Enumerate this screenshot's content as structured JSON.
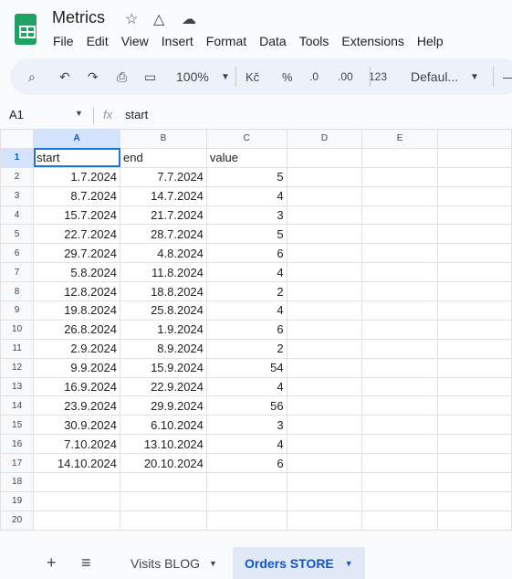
{
  "app": {
    "title": "Metrics",
    "menu": [
      "File",
      "Edit",
      "View",
      "Insert",
      "Format",
      "Data",
      "Tools",
      "Extensions",
      "Help"
    ]
  },
  "toolbar": {
    "zoom": "100%",
    "currency": "Kč",
    "percent": "%",
    "dec_decrease": ".0",
    "dec_increase": ".00",
    "number_format": "123",
    "font": "Defaul..."
  },
  "formula_bar": {
    "cell_ref": "A1",
    "fx": "fx",
    "value": "start"
  },
  "sheet": {
    "columns": [
      "A",
      "B",
      "C",
      "D",
      "E"
    ],
    "rows": [
      [
        "start",
        "end",
        "value"
      ],
      [
        "1.7.2024",
        "7.7.2024",
        "5"
      ],
      [
        "8.7.2024",
        "14.7.2024",
        "4"
      ],
      [
        "15.7.2024",
        "21.7.2024",
        "3"
      ],
      [
        "22.7.2024",
        "28.7.2024",
        "5"
      ],
      [
        "29.7.2024",
        "4.8.2024",
        "6"
      ],
      [
        "5.8.2024",
        "11.8.2024",
        "4"
      ],
      [
        "12.8.2024",
        "18.8.2024",
        "2"
      ],
      [
        "19.8.2024",
        "25.8.2024",
        "4"
      ],
      [
        "26.8.2024",
        "1.9.2024",
        "6"
      ],
      [
        "2.9.2024",
        "8.9.2024",
        "2"
      ],
      [
        "9.9.2024",
        "15.9.2024",
        "54"
      ],
      [
        "16.9.2024",
        "22.9.2024",
        "4"
      ],
      [
        "23.9.2024",
        "29.9.2024",
        "56"
      ],
      [
        "30.9.2024",
        "6.10.2024",
        "3"
      ],
      [
        "7.10.2024",
        "13.10.2024",
        "4"
      ],
      [
        "14.10.2024",
        "20.10.2024",
        "6"
      ],
      [
        "",
        "",
        ""
      ],
      [
        "",
        "",
        ""
      ],
      [
        "",
        "",
        ""
      ]
    ]
  },
  "tabs": {
    "add": "+",
    "list": "≡",
    "items": [
      "Visits BLOG",
      "Orders STORE"
    ],
    "active_color": "#0b57d0"
  }
}
